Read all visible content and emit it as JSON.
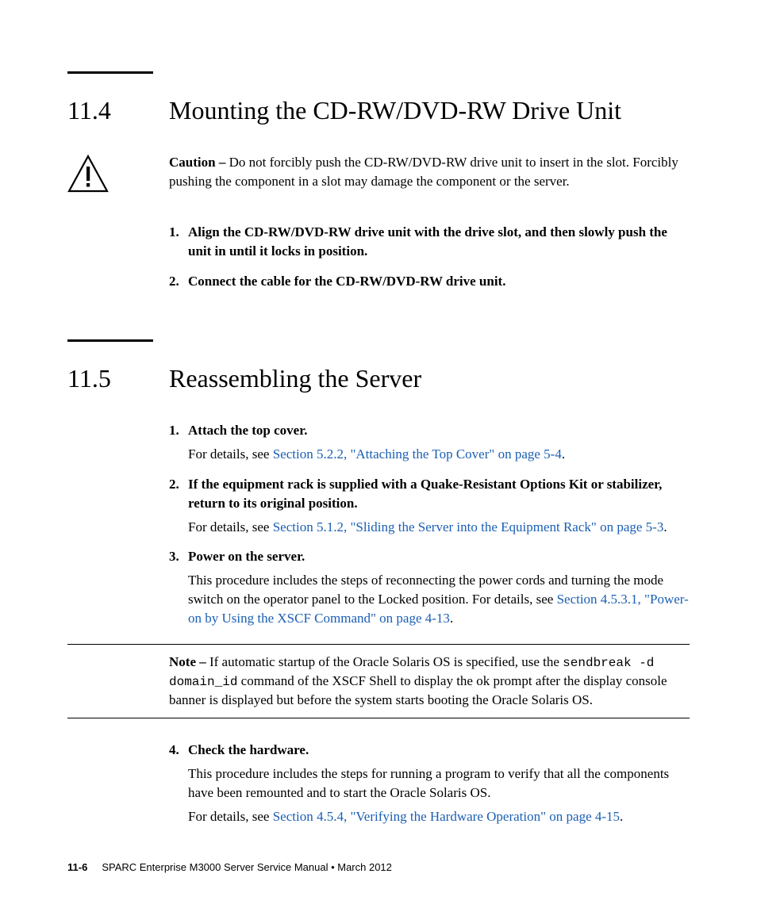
{
  "section1": {
    "num": "11.4",
    "title": "Mounting the CD-RW/DVD-RW Drive Unit"
  },
  "caution": {
    "label": "Caution –",
    "text": " Do not forcibly push the CD-RW/DVD-RW drive unit to insert in the slot. Forcibly pushing the component in a slot may damage the component or the server."
  },
  "steps1": [
    {
      "n": "1.",
      "strong": "Align the CD-RW/DVD-RW drive unit with the drive slot, and then slowly push the unit in until it locks in position."
    },
    {
      "n": "2.",
      "strong": "Connect the cable for the CD-RW/DVD-RW drive unit."
    }
  ],
  "section2": {
    "num": "11.5",
    "title": "Reassembling the Server"
  },
  "steps2": [
    {
      "n": "1.",
      "strong": "Attach the top cover.",
      "detail_pre": "For details, see ",
      "link": "Section 5.2.2, \"Attaching the Top Cover\" on page 5-4",
      "detail_post": "."
    },
    {
      "n": "2.",
      "strong": "If the equipment rack is supplied with a Quake-Resistant Options Kit or stabilizer, return to its original position.",
      "detail_pre": "For details, see ",
      "link": "Section 5.1.2, \"Sliding the Server into the Equipment Rack\" on page 5-3",
      "detail_post": "."
    },
    {
      "n": "3.",
      "strong": "Power on the server.",
      "detail_pre": "This procedure includes the steps of reconnecting the power cords and turning the mode switch on the operator panel to the Locked position. For details, see ",
      "link": "Section 4.5.3.1, \"Power-on by Using the XSCF Command\" on page 4-13",
      "detail_post": "."
    }
  ],
  "note": {
    "label": "Note –",
    "pre": " If automatic startup of the Oracle Solaris OS is specified, use the ",
    "code": "sendbreak -d domain_id",
    "post": " command of the XSCF Shell to display the ok prompt after the display console banner is displayed but before the system starts booting the Oracle Solaris OS."
  },
  "steps3": [
    {
      "n": "4.",
      "strong": "Check the hardware.",
      "p1": "This procedure includes the steps for running a program to verify that all the components have been remounted and to start the Oracle Solaris OS.",
      "detail_pre": "For details, see ",
      "link": "Section 4.5.4, \"Verifying the Hardware Operation\" on page 4-15",
      "detail_post": "."
    }
  ],
  "footer": {
    "pagenum": "11-6",
    "title": "SPARC Enterprise M3000 Server Service Manual  •  March 2012"
  }
}
